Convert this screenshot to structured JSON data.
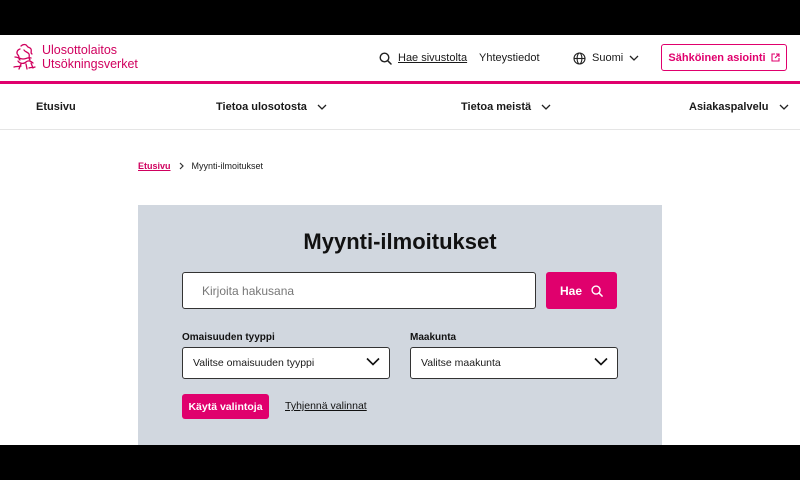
{
  "brand": {
    "name_fi": "Ulosottolaitos",
    "name_sv": "Utsökningsverket",
    "accent_color": "#e0006d",
    "logo_icon": "lion-emblem-icon"
  },
  "header": {
    "search_label": "Hae sivustolta",
    "contact_label": "Yhteystiedot",
    "language_label": "Suomi",
    "eservice_label": "Sähköinen asiointi"
  },
  "nav": {
    "items": [
      {
        "label": "Etusivu"
      },
      {
        "label": "Tietoa ulosotosta"
      },
      {
        "label": "Tietoa meistä"
      },
      {
        "label": "Asiakaspalvelu"
      }
    ]
  },
  "breadcrumb": {
    "home": "Etusivu",
    "current": "Myynti-ilmoitukset"
  },
  "search": {
    "title": "Myynti-ilmoitukset",
    "placeholder": "Kirjoita hakusana",
    "button_label": "Hae",
    "property_type_label": "Omaisuuden tyyppi",
    "property_type_value": "Valitse omaisuuden tyyppi",
    "region_label": "Maakunta",
    "region_value": "Valitse maakunta",
    "apply_label": "Käytä valintoja",
    "clear_label": "Tyhjennä valinnat"
  }
}
